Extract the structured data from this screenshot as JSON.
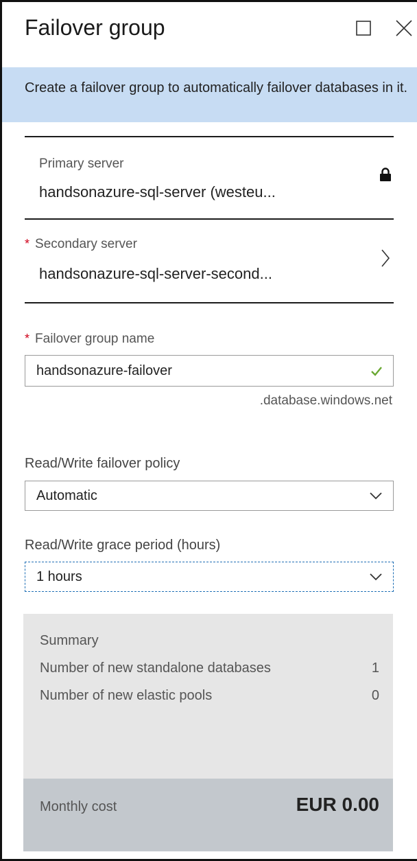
{
  "blade": {
    "title": "Failover group"
  },
  "info": {
    "message": "Create a failover group to automatically failover databases in it."
  },
  "primary_server": {
    "label": "Primary server",
    "value": "handsonazure-sql-server (westeu...",
    "icon": "lock-icon"
  },
  "secondary_server": {
    "required_mark": "*",
    "label": "Secondary server",
    "value": "handsonazure-sql-server-second...",
    "icon": "chevron-right-icon"
  },
  "failover_group_name": {
    "required_mark": "*",
    "label": "Failover group name",
    "value": "handsonazure-failover",
    "suffix": ".database.windows.net",
    "valid_icon": "checkmark-icon"
  },
  "failover_policy": {
    "label": "Read/Write failover policy",
    "selected": "Automatic"
  },
  "grace_period": {
    "label": "Read/Write grace period (hours)",
    "selected": "1 hours"
  },
  "summary": {
    "title": "Summary",
    "rows": [
      {
        "label": "Number of new standalone databases",
        "value": "1"
      },
      {
        "label": "Number of new elastic pools",
        "value": "0"
      }
    ]
  },
  "cost": {
    "label": "Monthly cost",
    "value": "EUR 0.00"
  },
  "colors": {
    "info_bar": "#c7dcf3",
    "required": "#d0021b",
    "valid": "#6aa832",
    "summary_bg": "#e6e6e6",
    "cost_bg": "#c3c8cd"
  }
}
